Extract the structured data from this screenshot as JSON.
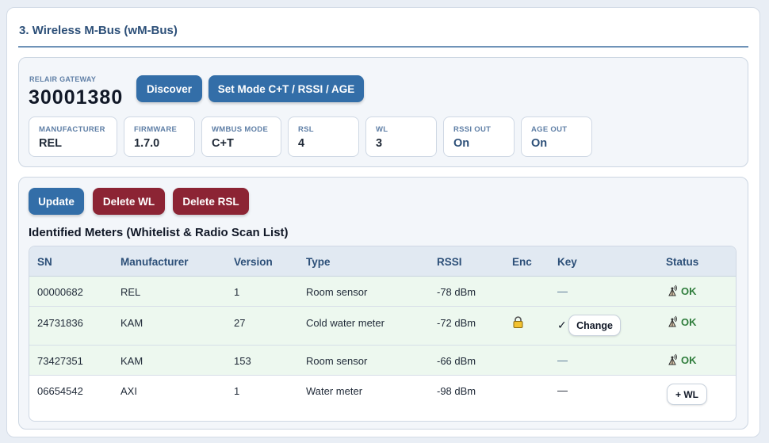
{
  "section": {
    "title": "3. Wireless M-Bus (wM-Bus)"
  },
  "gateway": {
    "label": "RELAIR GATEWAY",
    "serial": "30001380",
    "discover_label": "Discover",
    "set_mode_label": "Set Mode C+T / RSSI / AGE",
    "info": [
      {
        "label": "MANUFACTURER",
        "value": "REL"
      },
      {
        "label": "FIRMWARE",
        "value": "1.7.0"
      },
      {
        "label": "WMBUS MODE",
        "value": "C+T"
      },
      {
        "label": "RSL",
        "value": "4"
      },
      {
        "label": "WL",
        "value": "3"
      },
      {
        "label": "RSSI OUT",
        "value": "On"
      },
      {
        "label": "AGE OUT",
        "value": "On"
      }
    ]
  },
  "actions": {
    "update_label": "Update",
    "delete_wl_label": "Delete WL",
    "delete_rsl_label": "Delete RSL"
  },
  "meters": {
    "heading": "Identified Meters (Whitelist & Radio Scan List)",
    "columns": [
      "SN",
      "Manufacturer",
      "Version",
      "Type",
      "RSSI",
      "Enc",
      "Key",
      "Status"
    ],
    "rows": [
      {
        "sn": "00000682",
        "manufacturer": "REL",
        "version": "1",
        "type": "Room sensor",
        "rssi": "-78 dBm",
        "enc": "",
        "key": "—",
        "key_action": "",
        "status": "OK",
        "status_action": ""
      },
      {
        "sn": "24731836",
        "manufacturer": "KAM",
        "version": "27",
        "type": "Cold water meter",
        "rssi": "-72 dBm",
        "enc": "lock-icon",
        "key": "✓",
        "key_action": "Change",
        "status": "OK",
        "status_action": ""
      },
      {
        "sn": "73427351",
        "manufacturer": "KAM",
        "version": "153",
        "type": "Room sensor",
        "rssi": "-66 dBm",
        "enc": "",
        "key": "—",
        "key_action": "",
        "status": "OK",
        "status_action": ""
      },
      {
        "sn": "06654542",
        "manufacturer": "AXI",
        "version": "1",
        "type": "Water meter",
        "rssi": "-98 dBm",
        "enc": "",
        "key": "—",
        "key_action": "",
        "status": "",
        "status_action": "+ WL"
      }
    ]
  },
  "colors": {
    "accent": "#336ea8",
    "danger": "#8c2434",
    "ok_green": "#2f7d3c",
    "whitelist_row": "#edf8ef"
  }
}
